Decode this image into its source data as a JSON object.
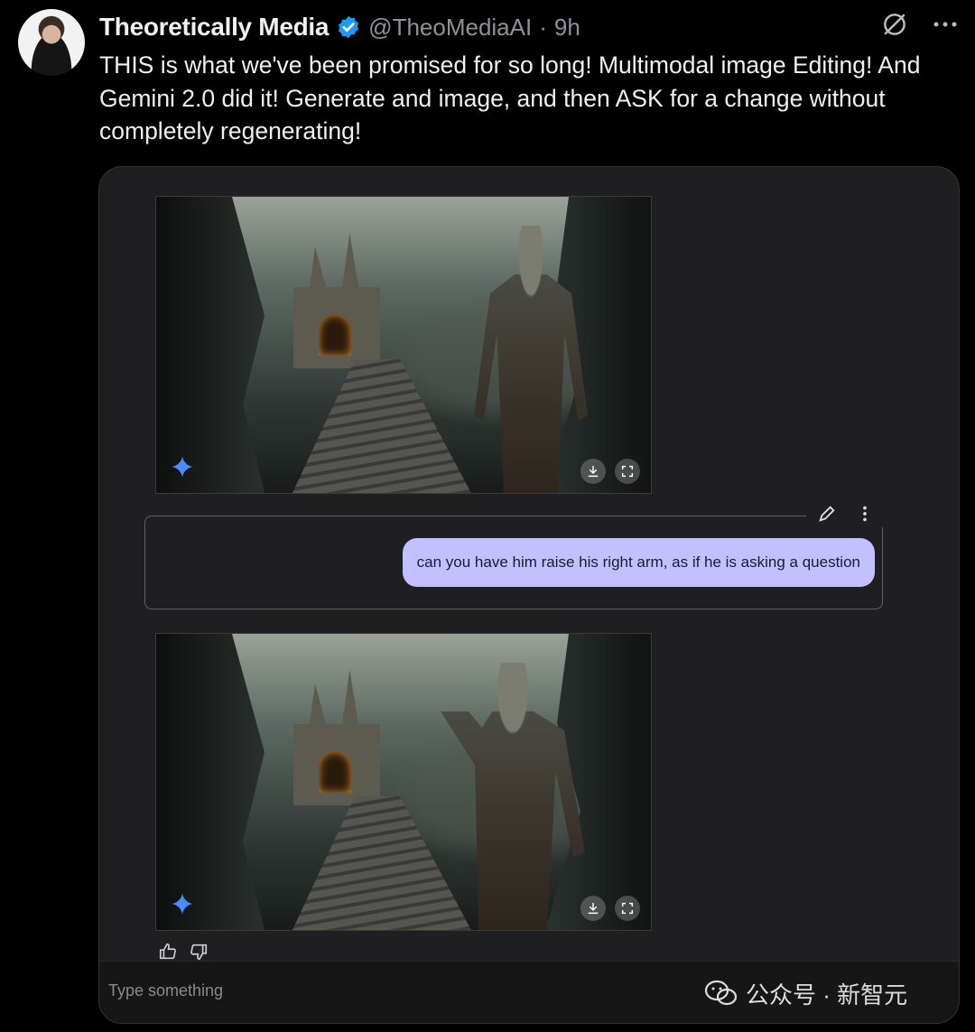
{
  "tweet": {
    "author_name": "Theoretically Media",
    "handle": "@TheoMediaAI",
    "separator": "·",
    "time": "9h",
    "text": "THIS is what we've been promised for so long! Multimodal image Editing! And Gemini 2.0 did it! Generate and image, and then ASK for a change without completely regenerating!"
  },
  "chat": {
    "prompt": "can you have him raise his right arm, as if he is asking a question",
    "input_placeholder": "Type something"
  },
  "watermark": {
    "text": "公众号 · 新智元"
  },
  "icons": {
    "verified": "verified-badge-icon",
    "grok": "grok-icon",
    "more": "more-icon",
    "sparkle": "gemini-sparkle-icon",
    "download": "download-icon",
    "fullscreen": "fullscreen-icon",
    "edit": "pencil-icon",
    "kebab": "kebab-icon",
    "thumbs_up": "thumbs-up-icon",
    "thumbs_down": "thumbs-down-icon"
  },
  "colors": {
    "background": "#000000",
    "card": "#1f1f21",
    "bubble": "#c3c0ff",
    "verified": "#1d9bf0",
    "sparkle": "#4a8cff"
  }
}
